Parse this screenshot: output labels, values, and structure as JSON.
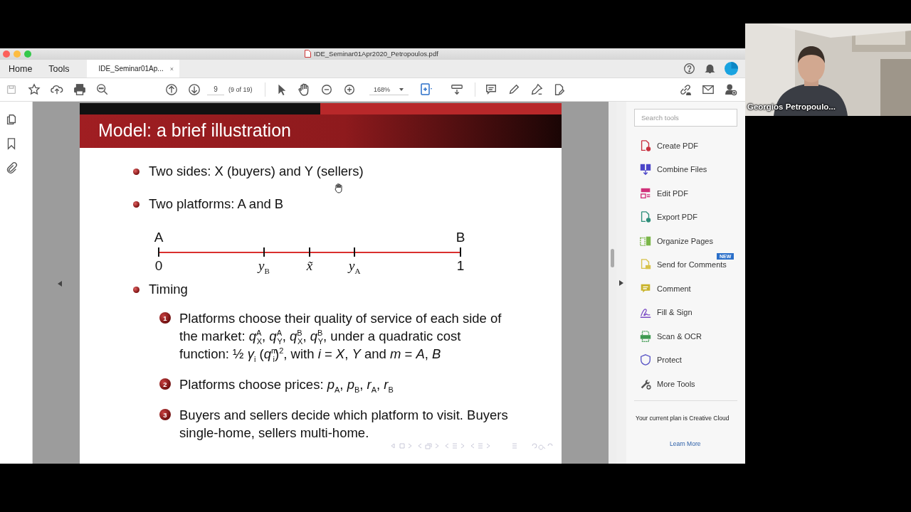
{
  "window": {
    "title": "IDE_Seminar01Apr2020_Petropoulos.pdf"
  },
  "tabs": [
    {
      "label": "Home",
      "kind": "view",
      "selected": false
    },
    {
      "label": "Tools",
      "kind": "view",
      "selected": false
    },
    {
      "label": "IDE_Seminar01Ap...",
      "kind": "document",
      "selected": true
    }
  ],
  "toolbar": {
    "page_number": "9",
    "page_count": "(9 of 19)",
    "zoom": "168%"
  },
  "tools_pane": {
    "search": {
      "placeholder": "Search tools"
    },
    "items": [
      {
        "label": "Create PDF",
        "color": "#c8303f"
      },
      {
        "label": "Combine Files",
        "color": "#4b45c8"
      },
      {
        "label": "Edit PDF",
        "color": "#d0317a"
      },
      {
        "label": "Export PDF",
        "color": "#2f8f7a"
      },
      {
        "label": "Organize Pages",
        "color": "#7ab648"
      },
      {
        "label": "Send for Comments",
        "color": "#d8c24a",
        "badge": "NEW"
      },
      {
        "label": "Comment",
        "color": "#c9b42c"
      },
      {
        "label": "Fill & Sign",
        "color": "#7a4bc4"
      },
      {
        "label": "Scan & OCR",
        "color": "#3f9a52"
      },
      {
        "label": "Protect",
        "color": "#5b57c6"
      },
      {
        "label": "More Tools",
        "color": "#555555"
      }
    ],
    "plan_note": "Your current plan is Creative Cloud",
    "link": "Learn More"
  },
  "slide": {
    "title": "Model: a brief illustration",
    "bullets": [
      "Two sides: X (buyers) and Y (sellers)",
      "Two platforms: A and B"
    ],
    "line_ends": [
      "A",
      "B"
    ],
    "axis_labels": [
      "0",
      "*y*$_{B}$",
      "*x̃*",
      "*y*$_{A}$",
      "1"
    ],
    "section": "Timing",
    "steps": [
      {
        "number": "1",
        "text": "Platforms choose their quality of service of each side of the market: *q*$^{A}$$_{X}$, *q*$^{A}$$_{Y}$, *q*$^{B}$$_{X}$, *q*$^{B}$$_{Y}$, under a quadratic cost function: ½ *γ*$_{i}$ (*q*$^{m}$$_{i}$)$^{2}$, with *i* = *X*, *Y* and *m* = *A*, *B*"
      },
      {
        "number": "2",
        "text": "Platforms choose prices: *p*$_{A}$, *p*$_{B}$, *r*$_{A}$, *r*$_{B}$"
      },
      {
        "number": "3",
        "text": "Buyers and sellers decide which platform to visit. Buyers single-home, sellers multi-home."
      }
    ]
  },
  "video": {
    "name": "Georgios Petropoulo..."
  }
}
